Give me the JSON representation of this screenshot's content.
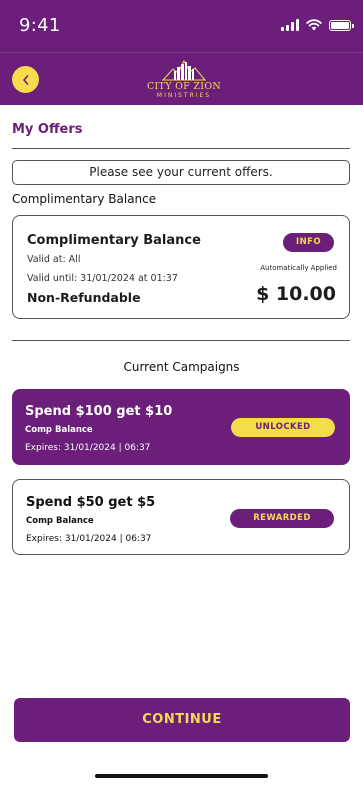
{
  "status_bar": {
    "time": "9:41"
  },
  "header": {
    "logo_line1": "CITY OF ZION",
    "logo_line2": "MINISTRIES"
  },
  "page": {
    "title": "My Offers",
    "notice": "Please see your current offers."
  },
  "balance_section": {
    "label": "Complimentary Balance",
    "card": {
      "title": "Complimentary Balance",
      "valid_at": "Valid at: All",
      "valid_until": "Valid until: 31/01/2024 at 01:37",
      "non_refundable": "Non-Refundable",
      "info_label": "INFO",
      "auto_applied": "Automatically Applied",
      "amount": "$ 10.00"
    }
  },
  "campaigns": {
    "label": "Current Campaigns",
    "items": [
      {
        "title": "Spend $100 get $10",
        "type": "Comp Balance",
        "expires": "Expires: 31/01/2024 | 06:37",
        "status": "UNLOCKED"
      },
      {
        "title": "Spend $50 get $5",
        "type": "Comp Balance",
        "expires": "Expires: 31/01/2024 | 06:37",
        "status": "REWARDED"
      }
    ]
  },
  "footer": {
    "continue_label": "CONTINUE"
  },
  "colors": {
    "brand_purple": "#6b1f7a",
    "accent_yellow": "#f5dc4c"
  },
  "icons": {
    "back": "chevron-left-icon",
    "signal": "signal-icon",
    "wifi": "wifi-icon",
    "battery": "battery-icon"
  }
}
